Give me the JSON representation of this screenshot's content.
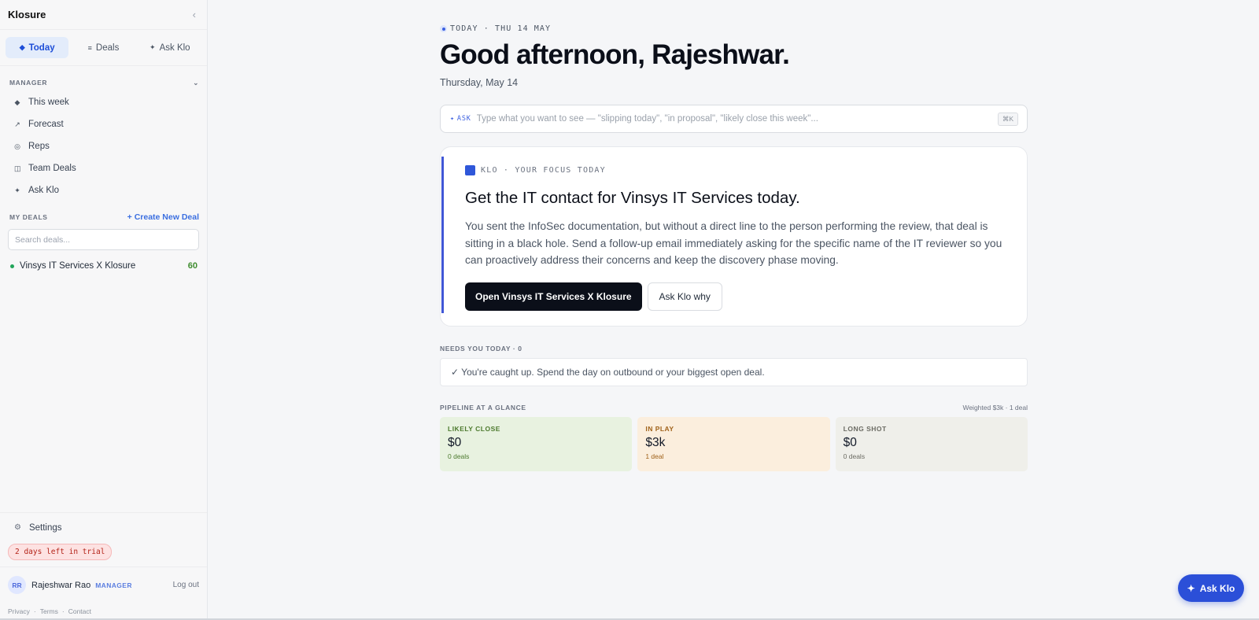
{
  "sidebar": {
    "brand": "Klosure",
    "collapse_icon": "‹",
    "tabs": [
      {
        "label": "Today",
        "icon": "◆"
      },
      {
        "label": "Deals",
        "icon": "≡"
      },
      {
        "label": "Ask Klo",
        "icon": "✦"
      }
    ],
    "manager_heading": "MANAGER",
    "manager_chevron": "⌄",
    "nav": [
      {
        "label": "This week",
        "icon": "◆"
      },
      {
        "label": "Forecast",
        "icon": "↗"
      },
      {
        "label": "Reps",
        "icon": "◎"
      },
      {
        "label": "Team Deals",
        "icon": "◫"
      },
      {
        "label": "Ask Klo",
        "icon": "✦"
      }
    ],
    "my_deals_heading": "MY DEALS",
    "create_deal": "+ Create New Deal",
    "search_placeholder": "Search deals...",
    "deals": [
      {
        "name": "Vinsys IT Services X Klosure",
        "score": "60"
      }
    ],
    "settings": {
      "label": "Settings",
      "icon": "⚙"
    },
    "trial_badge": "2 days left in trial",
    "user": {
      "initials": "RR",
      "name": "Rajeshwar Rao",
      "role": "MANAGER",
      "logout": "Log out"
    },
    "footer": {
      "privacy": "Privacy",
      "terms": "Terms",
      "contact": "Contact",
      "sep": "·"
    }
  },
  "main": {
    "dateline": "TODAY · THU 14 MAY",
    "greeting": "Good afternoon, Rajeshwar.",
    "subdate": "Thursday, May 14",
    "ask": {
      "tag": "ASK",
      "tag_icon": "✦",
      "placeholder": "Type what you want to see — \"slipping today\", \"in proposal\", \"likely close this week\"...",
      "shortcut": "⌘K"
    },
    "focus": {
      "tag": "KLO · YOUR FOCUS TODAY",
      "title": "Get the IT contact for Vinsys IT Services today.",
      "body": "You sent the InfoSec documentation, but without a direct line to the person performing the review, that deal is sitting in a black hole. Send a follow-up email immediately asking for the specific name of the IT reviewer so you can proactively address their concerns and keep the discovery phase moving.",
      "primary_button": "Open Vinsys IT Services X Klosure",
      "secondary_button": "Ask Klo why"
    },
    "needs": {
      "heading": "NEEDS YOU TODAY · 0",
      "message": "✓ You're caught up. Spend the day on outbound or your biggest open deal."
    },
    "pipeline": {
      "heading": "PIPELINE AT A GLANCE",
      "summary": "Weighted $3k · 1 deal",
      "cards": [
        {
          "label": "LIKELY CLOSE",
          "value": "$0",
          "count": "0 deals"
        },
        {
          "label": "IN PLAY",
          "value": "$3k",
          "count": "1 deal"
        },
        {
          "label": "LONG SHOT",
          "value": "$0",
          "count": "0 deals"
        }
      ]
    }
  },
  "fab": {
    "label": "Ask Klo",
    "icon": "✦"
  },
  "colors": {
    "accent": "#2b4fd8",
    "dark_button": "#0b0f19",
    "likely_close_bg": "#e8f2e0",
    "in_play_bg": "#fbeedd",
    "long_shot_bg": "#efefea",
    "trial_bg": "#fde2e2"
  }
}
